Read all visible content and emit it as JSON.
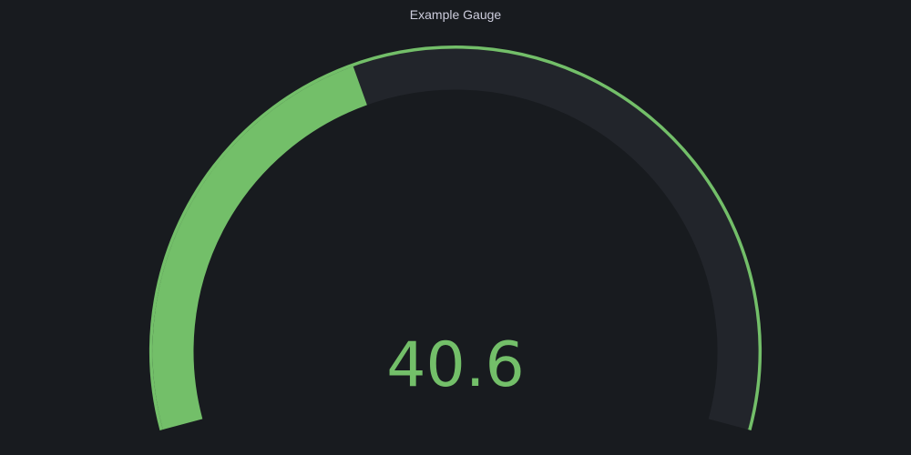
{
  "panel": {
    "title": "Example Gauge"
  },
  "gauge": {
    "value": 40.6,
    "value_text": "40.6",
    "min": 0,
    "max": 100,
    "thresholds": [
      {
        "from": 0,
        "to": 100,
        "color": "#73bf69"
      }
    ]
  },
  "colors": {
    "background": "#181b1f",
    "track": "#22252b",
    "fill": "#73bf69",
    "title_text": "#ccccdc"
  }
}
